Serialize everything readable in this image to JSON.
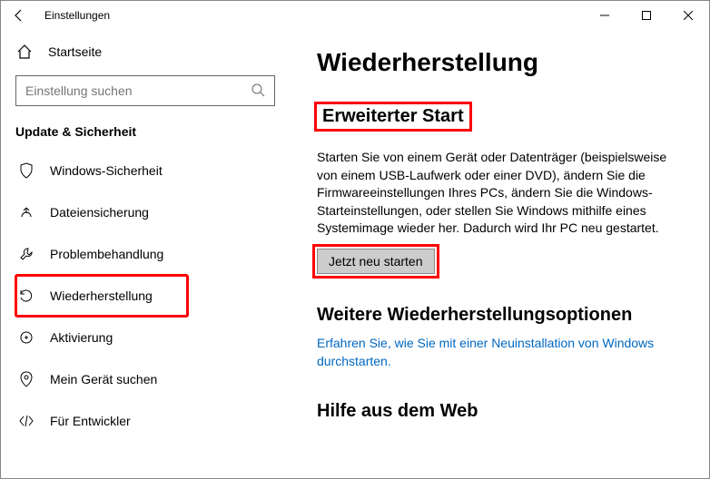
{
  "window": {
    "title": "Einstellungen"
  },
  "sidebar": {
    "home": "Startseite",
    "search_placeholder": "Einstellung suchen",
    "group": "Update & Sicherheit",
    "items": [
      {
        "icon": "shield",
        "label": "Windows-Sicherheit"
      },
      {
        "icon": "backup",
        "label": "Dateiensicherung"
      },
      {
        "icon": "troubleshoot",
        "label": "Problembehandlung"
      },
      {
        "icon": "recovery",
        "label": "Wiederherstellung",
        "selected": true
      },
      {
        "icon": "activation",
        "label": "Aktivierung"
      },
      {
        "icon": "findmydevice",
        "label": "Mein Gerät suchen"
      },
      {
        "icon": "developer",
        "label": "Für Entwickler"
      }
    ]
  },
  "content": {
    "h1": "Wiederherstellung",
    "advanced": {
      "heading": "Erweiterter Start",
      "desc": "Starten Sie von einem Gerät oder Datenträger (beispielsweise von einem USB-Laufwerk oder einer DVD), ändern Sie die Firmwareeinstellungen Ihres PCs, ändern Sie die Windows-Starteinstellungen, oder stellen Sie Windows mithilfe eines Systemimage wieder her. Dadurch wird Ihr PC neu gestartet.",
      "button": "Jetzt neu starten"
    },
    "more": {
      "heading": "Weitere Wiederherstellungsoptionen",
      "link": "Erfahren Sie, wie Sie mit einer Neuinstallation von Windows durchstarten."
    },
    "help": {
      "heading": "Hilfe aus dem Web"
    }
  }
}
